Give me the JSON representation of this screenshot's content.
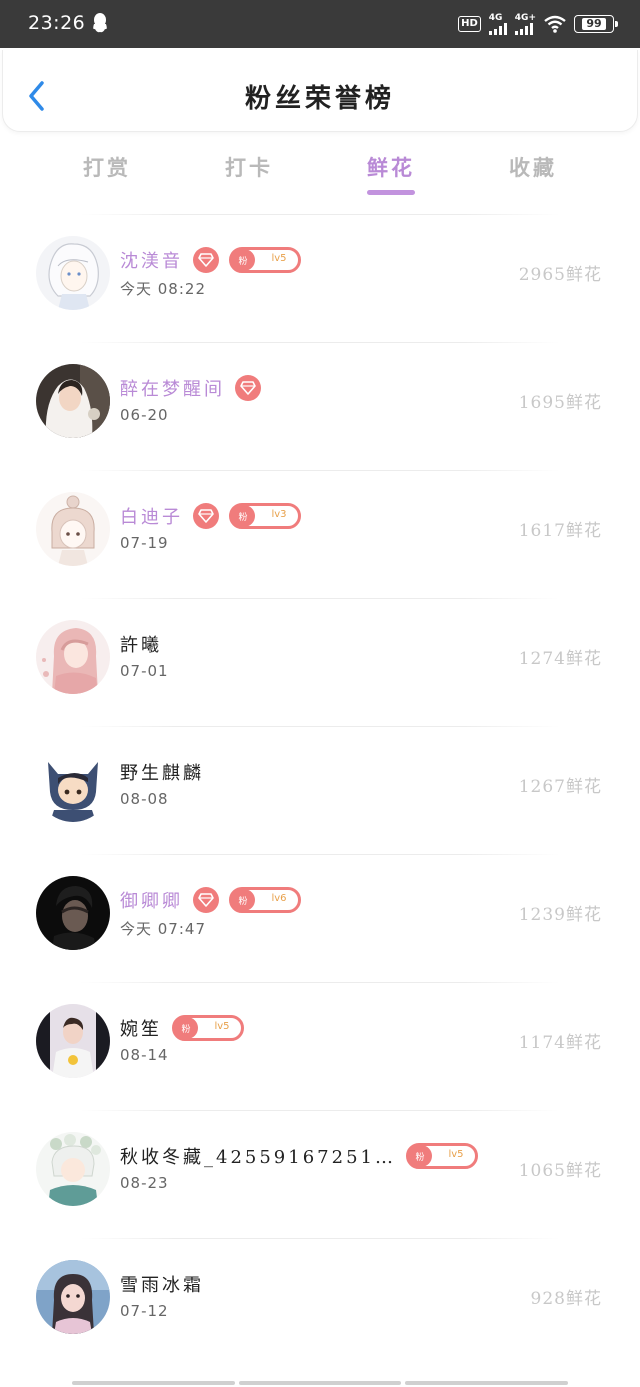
{
  "status_bar": {
    "time": "23:26",
    "network1": "4G",
    "network2": "4G+",
    "hd_label": "HD",
    "battery": "99"
  },
  "header": {
    "title": "粉丝荣誉榜"
  },
  "tabs": [
    {
      "label": "打赏",
      "active": false
    },
    {
      "label": "打卡",
      "active": false
    },
    {
      "label": "鲜花",
      "active": true
    },
    {
      "label": "收藏",
      "active": false
    }
  ],
  "badge_fan_label": "粉",
  "colors": {
    "accent": "#b98ad6",
    "badge": "#f07c7c",
    "muted": "#c8c8c8"
  },
  "fans": [
    {
      "name": "沈渼音",
      "vip": true,
      "gem": true,
      "level": "lv5",
      "time": "今天  08:22",
      "score": "2965鲜花"
    },
    {
      "name": "醉在梦醒间",
      "vip": true,
      "gem": true,
      "level": null,
      "time": "06-20",
      "score": "1695鲜花"
    },
    {
      "name": "白迪子",
      "vip": true,
      "gem": true,
      "level": "lv3",
      "time": "07-19",
      "score": "1617鲜花"
    },
    {
      "name": "許曦",
      "vip": false,
      "gem": false,
      "level": null,
      "time": "07-01",
      "score": "1274鲜花"
    },
    {
      "name": "野生麒麟",
      "vip": false,
      "gem": false,
      "level": null,
      "time": "08-08",
      "score": "1267鲜花"
    },
    {
      "name": "御卿卿",
      "vip": true,
      "gem": true,
      "level": "lv6",
      "time": "今天  07:47",
      "score": "1239鲜花"
    },
    {
      "name": "婉笙",
      "vip": false,
      "gem": false,
      "level": "lv5",
      "time": "08-14",
      "score": "1174鲜花"
    },
    {
      "name": "秋收冬藏_42559167251…",
      "vip": false,
      "gem": false,
      "level": "lv5",
      "time": "08-23",
      "score": "1065鲜花"
    },
    {
      "name": "雪雨冰霜",
      "vip": false,
      "gem": false,
      "level": null,
      "time": "07-12",
      "score": "928鲜花"
    }
  ]
}
